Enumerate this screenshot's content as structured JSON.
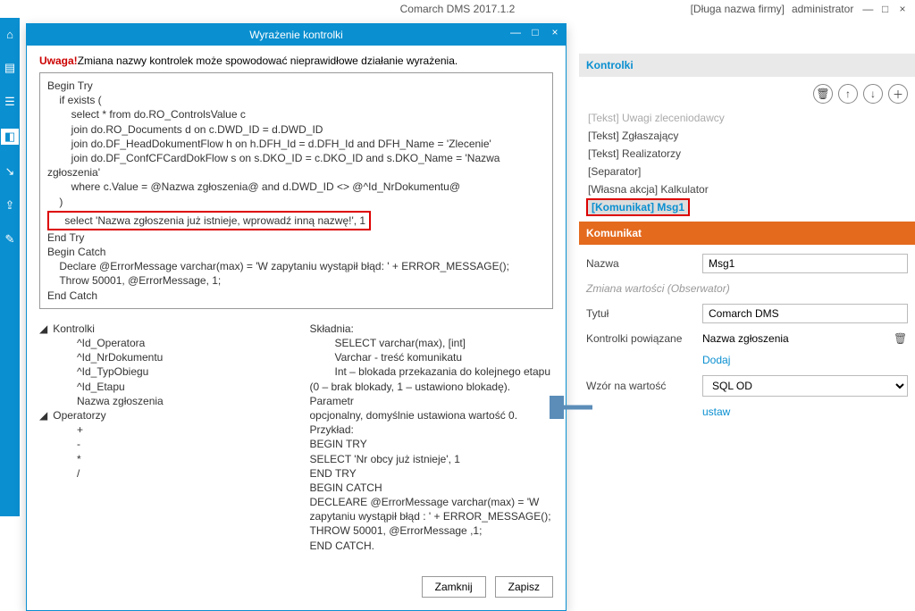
{
  "app": {
    "title": "Comarch DMS 2017.1.2",
    "company": "[Długa nazwa firmy]",
    "user": "administrator"
  },
  "modal": {
    "title": "Wyrażenie kontrolki",
    "warning_tag": "Uwaga!",
    "warning_text": "Zmiana nazwy kontrolek może spowodować nieprawidłowe działanie wyrażenia.",
    "code_lines": [
      "Begin Try",
      "    if exists (",
      "        select * from do.RO_ControlsValue c",
      "        join do.RO_Documents d on c.DWD_ID = d.DWD_ID",
      "        join do.DF_HeadDokumentFlow h on h.DFH_Id = d.DFH_Id and DFH_Name = 'Zlecenie'",
      "        join do.DF_ConfCFCardDokFlow s on s.DKO_ID = c.DKO_ID and s.DKO_Name = 'Nazwa zgłoszenia'",
      "        where c.Value = @Nazwa zgłoszenia@ and d.DWD_ID <> @^Id_NrDokumentu@",
      "    )"
    ],
    "highlight_line": "    select 'Nazwa zgłoszenia już istnieje, wprowadź inną nazwę!', 1",
    "code_lines_after": [
      "End Try",
      "Begin Catch",
      "    Declare @ErrorMessage varchar(max) = 'W zapytaniu wystąpił błąd: ' + ERROR_MESSAGE();",
      "    Throw 50001, @ErrorMessage, 1;",
      "End Catch"
    ],
    "help": {
      "sec1_title": "Kontrolki",
      "sec1_items": [
        "^Id_Operatora",
        "^Id_NrDokumentu",
        "^Id_TypObiegu",
        "^Id_Etapu",
        "Nazwa zgłoszenia"
      ],
      "sec2_title": "Operatorzy",
      "sec2_items": [
        "+",
        "-",
        "*",
        "/"
      ],
      "syntax_title": "Składnia:",
      "syntax_lines": [
        "SELECT varchar(max), [int]",
        "Varchar - treść komunikatu",
        "Int – blokada przekazania do kolejnego etapu",
        "(0 – brak blokady, 1 – ustawiono blokadę). Parametr",
        "opcjonalny, domyślnie ustawiona wartość 0.",
        "Przykład:",
        "BEGIN TRY",
        "        SELECT 'Nr obcy już istnieje', 1",
        "END TRY",
        "BEGIN CATCH",
        "        DECLEARE @ErrorMessage varchar(max) = 'W",
        "zapytaniu wystąpił błąd : ' + ERROR_MESSAGE();",
        "        THROW 50001,  @ErrorMessage ,1;",
        "END CATCH."
      ]
    },
    "btn_close": "Zamknij",
    "btn_save": "Zapisz"
  },
  "rightPane": {
    "kontrolki_title": "Kontrolki",
    "list": [
      "[Tekst] Uwagi zleceniodawcy",
      "[Tekst] Zgłaszający",
      "[Tekst] Realizatorzy",
      "[Separator]",
      "[Własna akcja] Kalkulator"
    ],
    "selected": "[Komunikat] Msg1",
    "komunikat_title": "Komunikat",
    "form": {
      "nazwa_label": "Nazwa",
      "nazwa_value": "Msg1",
      "observer_label": "Zmiana wartości (Obserwator)",
      "tytul_label": "Tytuł",
      "tytul_value": "Comarch DMS",
      "linked_label": "Kontrolki powiązane",
      "linked_value": "Nazwa zgłoszenia",
      "add_link": "Dodaj",
      "wzor_label": "Wzór na wartość",
      "wzor_value": "SQL OD",
      "ustaw_link": "ustaw"
    }
  }
}
